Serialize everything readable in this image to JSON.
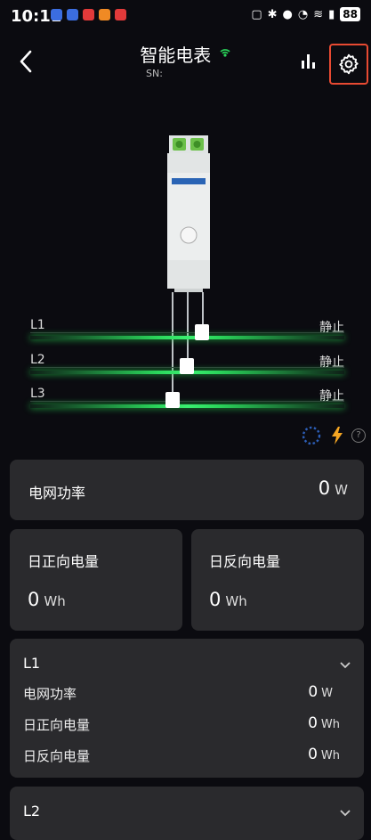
{
  "status_bar": {
    "time": "10:11",
    "battery": "88"
  },
  "header": {
    "title": "智能电表",
    "sn_label": "SN:"
  },
  "meter_lines": [
    {
      "name": "L1",
      "state": "静止"
    },
    {
      "name": "L2",
      "state": "静止"
    },
    {
      "name": "L3",
      "state": "静止"
    }
  ],
  "grid_power": {
    "label": "电网功率",
    "value": "0",
    "unit": "W"
  },
  "daily_forward": {
    "label": "日正向电量",
    "value": "0",
    "unit": "Wh"
  },
  "daily_reverse": {
    "label": "日反向电量",
    "value": "0",
    "unit": "Wh"
  },
  "phases": [
    {
      "title": "L1",
      "rows": [
        {
          "label": "电网功率",
          "value": "0",
          "unit": "W"
        },
        {
          "label": "日正向电量",
          "value": "0",
          "unit": "Wh"
        },
        {
          "label": "日反向电量",
          "value": "0",
          "unit": "Wh"
        }
      ]
    },
    {
      "title": "L2"
    }
  ],
  "colors": {
    "accent_green": "#2ad45a",
    "highlight_red": "#e84a32",
    "card_bg": "#2a2a2d"
  }
}
